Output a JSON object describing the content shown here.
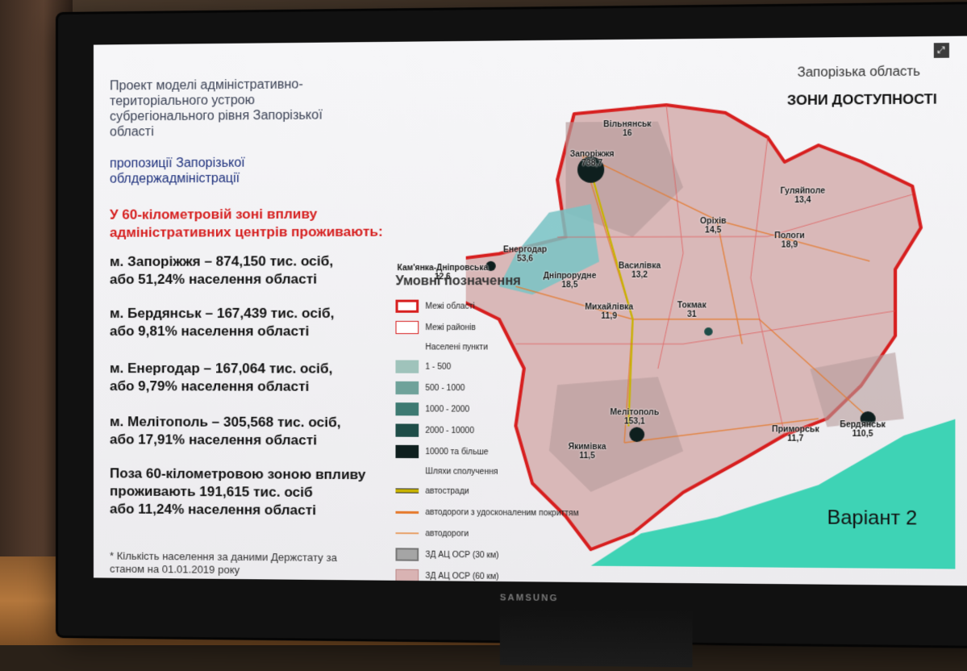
{
  "slide": {
    "title": "Проект моделі адміністративно-територіального устрою субрегіонального рівня Запорізької області",
    "subtitle": "пропозиції Запорізької облдержадміністрації",
    "red_heading": "У 60-кілометровій зоні впливу адміністративних центрів проживають:",
    "stats": [
      {
        "line1": "м. Запоріжжя  – 874,150  тис. осіб,",
        "line2": "або 51,24%  населення області"
      },
      {
        "line1": "м. Бердянськ – 167,439  тис. осіб,",
        "line2": "або 9,81% населення області"
      },
      {
        "line1": "м. Енергодар – 167,064  тис. осіб,",
        "line2": "або 9,79% населення області"
      },
      {
        "line1": "м. Мелітополь – 305,568  тис. осіб,",
        "line2": "або 17,91% населення області"
      }
    ],
    "outside": {
      "line1": "Поза 60-кілометровою зоною впливу",
      "line2": "проживають 191,615  тис. осіб",
      "line3": "або 11,24% населення області"
    },
    "footnote": "* Кількість населення за даними Держстату за станом на 01.01.2019 року"
  },
  "map": {
    "region_label": "Запорізька область",
    "zones_label": "ЗОНИ ДОСТУПНОСТІ",
    "variant": "Варіант 2",
    "cities": [
      {
        "name": "Вільнянськ",
        "pop": "16"
      },
      {
        "name": "Запоріжжя",
        "pop": "738,7"
      },
      {
        "name": "Гуляйполе",
        "pop": "13,4"
      },
      {
        "name": "Оріхів",
        "pop": "14,5"
      },
      {
        "name": "Пологи",
        "pop": "18,9"
      },
      {
        "name": "Енергодар",
        "pop": "53,6"
      },
      {
        "name": "Кам'янка-Дніпровська",
        "pop": "12,6"
      },
      {
        "name": "Дніпрорудне",
        "pop": "18,5"
      },
      {
        "name": "Василівка",
        "pop": "13,2"
      },
      {
        "name": "Михайлівка",
        "pop": "11,9"
      },
      {
        "name": "Токмак",
        "pop": "31"
      },
      {
        "name": "Мелітополь",
        "pop": "153,1"
      },
      {
        "name": "Приморськ",
        "pop": "11,7"
      },
      {
        "name": "Бердянськ",
        "pop": "110,5"
      },
      {
        "name": "Якимівка",
        "pop": "11,5"
      }
    ]
  },
  "legend": {
    "heading": "Умовні позначення",
    "border_region": "Межі області",
    "border_district": "Межі районів",
    "settlements_label": "Населені пункти",
    "settlement_classes": [
      {
        "label": "1 - 500",
        "color": "#9fc3bb"
      },
      {
        "label": "500 - 1000",
        "color": "#6fa29a"
      },
      {
        "label": "1000 - 2000",
        "color": "#3d7a72"
      },
      {
        "label": "2000 - 10000",
        "color": "#1e4d48"
      },
      {
        "label": "10000 та більше",
        "color": "#0e1f1e"
      }
    ],
    "roads_label": "Шляхи сполучення",
    "roads": [
      {
        "label": "автостради",
        "color": "#c8b300"
      },
      {
        "label": "автодороги з удосконаленим покриттям",
        "color": "#e5792b"
      },
      {
        "label": "автодороги",
        "color": "#e8a26a"
      }
    ],
    "zones": [
      {
        "label": "ЗД АЦ ОСР (30 км)",
        "color": "#a5a5a5"
      },
      {
        "label": "ЗД АЦ ОСР (60 км)",
        "color": "#d9b3b3"
      }
    ]
  },
  "device": {
    "brand": "SAMSUNG"
  }
}
